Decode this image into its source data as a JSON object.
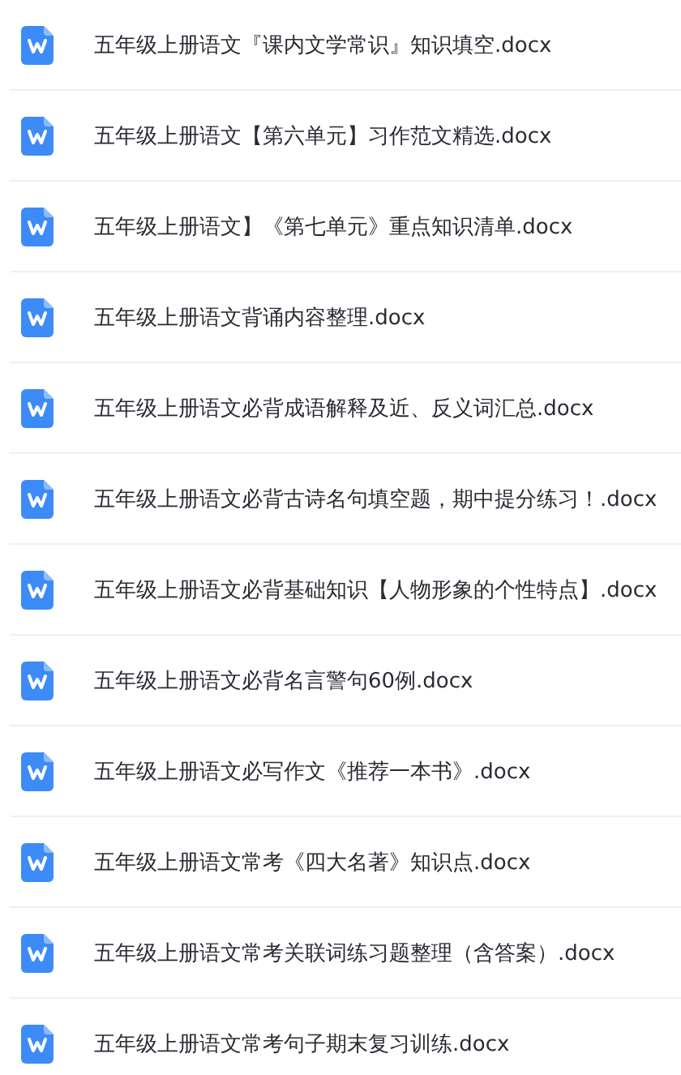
{
  "files": [
    {
      "name": "五年级上册语文『课内文学常识』知识填空.docx"
    },
    {
      "name": "五年级上册语文【第六单元】习作范文精选.docx"
    },
    {
      "name": "五年级上册语文】《第七单元》重点知识清单.docx"
    },
    {
      "name": "五年级上册语文背诵内容整理.docx"
    },
    {
      "name": "五年级上册语文必背成语解释及近、反义词汇总.docx"
    },
    {
      "name": "五年级上册语文必背古诗名句填空题，期中提分练习！.docx"
    },
    {
      "name": "五年级上册语文必背基础知识【人物形象的个性特点】.docx"
    },
    {
      "name": "五年级上册语文必背名言警句60例.docx"
    },
    {
      "name": "五年级上册语文必写作文《推荐一本书》.docx"
    },
    {
      "name": "五年级上册语文常考《四大名著》知识点.docx"
    },
    {
      "name": "五年级上册语文常考关联词练习题整理（含答案）.docx"
    },
    {
      "name": "五年级上册语文常考句子期末复习训练.docx"
    }
  ]
}
